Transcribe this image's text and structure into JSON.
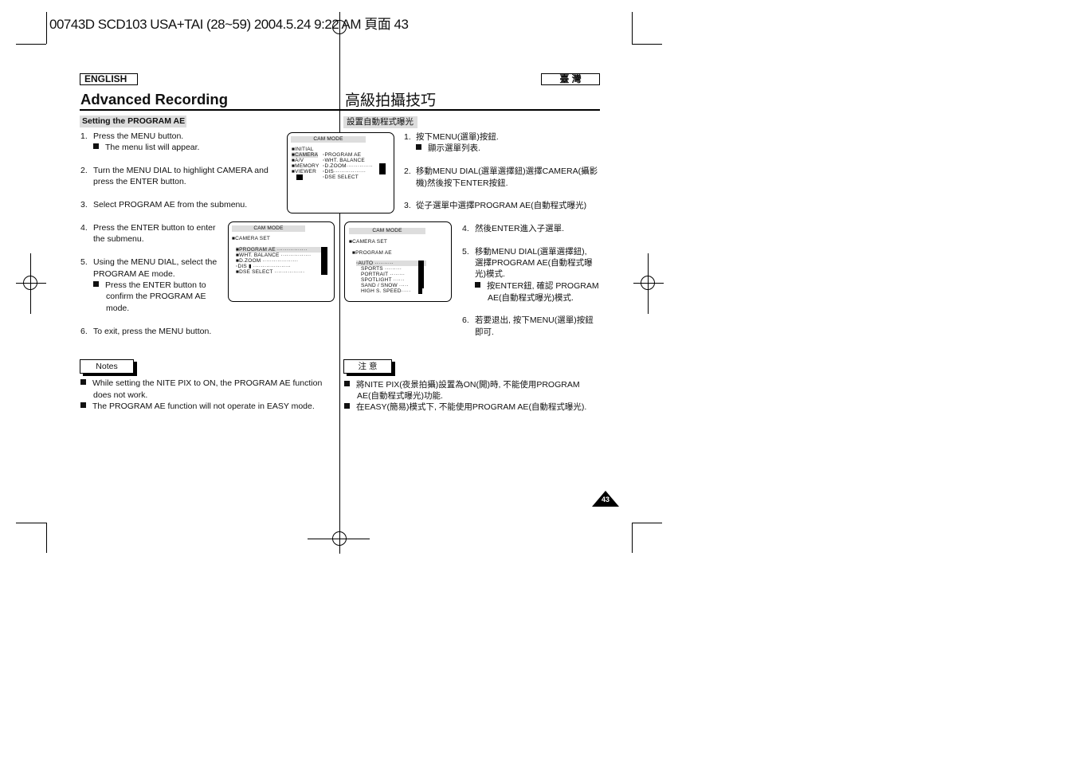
{
  "print_header": "00743D SCD103 USA+TAI (28~59) 2004.5.24 9:22 AM 頁面 43",
  "left": {
    "lang_badge": "ENGLISH",
    "title": "Advanced Recording",
    "section": "Setting the PROGRAM AE",
    "steps": [
      {
        "num": "1.",
        "text": "Press the MENU button.",
        "sub": "The menu list will appear."
      },
      {
        "num": "2.",
        "text": "Turn the MENU DIAL to highlight CAMERA and",
        "text2": "press the ENTER button."
      },
      {
        "num": "3.",
        "text": "Select PROGRAM AE from the submenu."
      },
      {
        "num": "4.",
        "text": "Press the ENTER button to enter",
        "text2": "the submenu."
      },
      {
        "num": "5.",
        "text": "Using the MENU DIAL, select the",
        "text2": "PROGRAM AE mode.",
        "sub": "Press the ENTER button to",
        "sub2": "confirm the PROGRAM AE",
        "sub3": "mode."
      },
      {
        "num": "6.",
        "text": "To exit, press the MENU button."
      }
    ],
    "notes_label": "Notes",
    "notes": [
      "While setting the NITE PIX to ON, the PROGRAM AE function",
      "does not work.",
      "The PROGRAM AE function will not operate in EASY mode."
    ]
  },
  "right": {
    "lang_badge": "臺 灣",
    "title": "高級拍攝技巧",
    "section": "設置自動程式曝光",
    "steps": [
      {
        "num": "1.",
        "text": "按下MENU(選單)按鈕.",
        "sub": "顯示選單列表."
      },
      {
        "num": "2.",
        "text": "移動MENU DIAL(選單選擇鈕)選擇CAMERA(攝影",
        "text2": "機)然後按下ENTER按鈕."
      },
      {
        "num": "3.",
        "text": "從子選單中選擇PROGRAM AE(自動程式曝光)"
      },
      {
        "num": "4.",
        "text": "然後ENTER進入子選單."
      },
      {
        "num": "5.",
        "text": "移動MENU DIAL(選單選擇鈕),",
        "text2": "選擇PROGRAM AE(自動程式曝",
        "text3": "光)模式.",
        "sub": "按ENTER鈕, 確認 PROGRAM",
        "sub2": "AE(自動程式曝光)模式."
      },
      {
        "num": "6.",
        "text": "若要退出, 按下MENU(選單)按鈕",
        "text2": "即可."
      }
    ],
    "notes_label": "注 意",
    "notes": [
      "將NITE PIX(夜景拍攝)設置為ON(開)時, 不能使用PROGRAM",
      "AE(自動程式曝光)功能.",
      "在EASY(簡易)模式下, 不能使用PROGRAM AE(自動程式曝光)."
    ]
  },
  "screen1": {
    "title": "CAM MODE",
    "items": [
      "INITIAL",
      "CAMERA",
      "A/V",
      "MEMORY",
      "VIEWER"
    ],
    "sub": [
      "PROGRAM AE",
      "WHT. BALANCE",
      "D.ZOOM",
      "DIS",
      "DSE SELECT"
    ]
  },
  "screen2": {
    "title": "CAM MODE",
    "head": "CAMERA SET",
    "items": [
      "PROGRAM AE",
      "WHT. BALANCE",
      "D.ZOOM",
      "DIS",
      "DSE SELECT"
    ]
  },
  "screen3": {
    "title": "CAM MODE",
    "head": "CAMERA SET",
    "head2": "PROGRAM AE",
    "items": [
      "AUTO",
      "SPORTS",
      "PORTRAIT",
      "SPOTLIGHT",
      "SAND / SNOW",
      "HIGH S. SPEED"
    ]
  },
  "page_number": "43"
}
